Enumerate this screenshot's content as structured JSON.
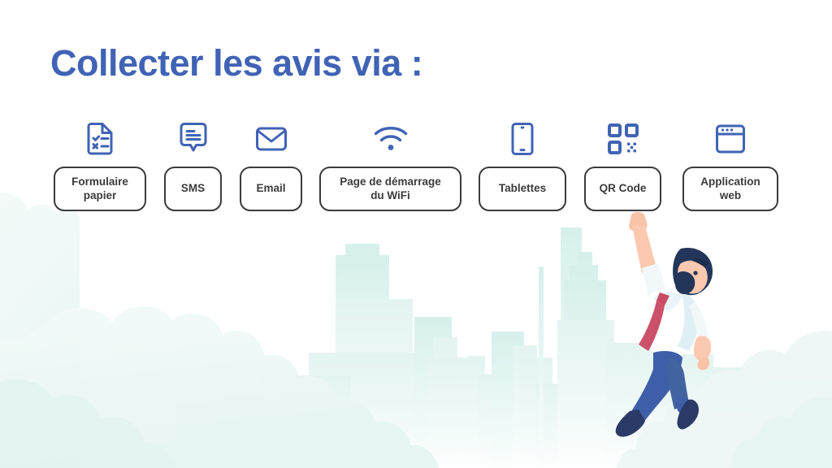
{
  "page": {
    "title": "Collecter les avis via :",
    "title_color": "#4063B5",
    "background_color": "#ffffff",
    "box_border_color": "#3B3B3B",
    "icon_color": "#4063B5",
    "skyline_color": "#DFF2EF",
    "cloud_color": "#EDF7F5"
  },
  "channels": [
    {
      "label": "Formulaire\npapier",
      "line1": "Formulaire",
      "line2": "papier",
      "icon": "document-check-x-icon"
    },
    {
      "label": "SMS",
      "line1": "SMS",
      "line2": "",
      "icon": "speech-bubble-lines-icon"
    },
    {
      "label": "Email",
      "line1": "Email",
      "line2": "",
      "icon": "envelope-icon"
    },
    {
      "label": "Page de démarrage du WiFi",
      "line1": "Page de démarrage",
      "line2": "du WiFi",
      "icon": "wifi-icon"
    },
    {
      "label": "Tablettes",
      "line1": "Tablettes",
      "line2": "",
      "icon": "tablet-icon"
    },
    {
      "label": "QR Code",
      "line1": "QR Code",
      "line2": "",
      "icon": "qr-code-icon"
    },
    {
      "label": "Application web",
      "line1": "Application",
      "line2": "web",
      "icon": "browser-window-icon"
    }
  ],
  "illustration": {
    "name": "man-jumping-reaching-qr-code",
    "skin_color": "#F7B79B",
    "shirt_color": "#FFFFFF",
    "tie_color": "#D4536B",
    "trousers_color": "#3E5FA8",
    "shoe_color": "#2B3A66",
    "hair_color": "#233659"
  }
}
